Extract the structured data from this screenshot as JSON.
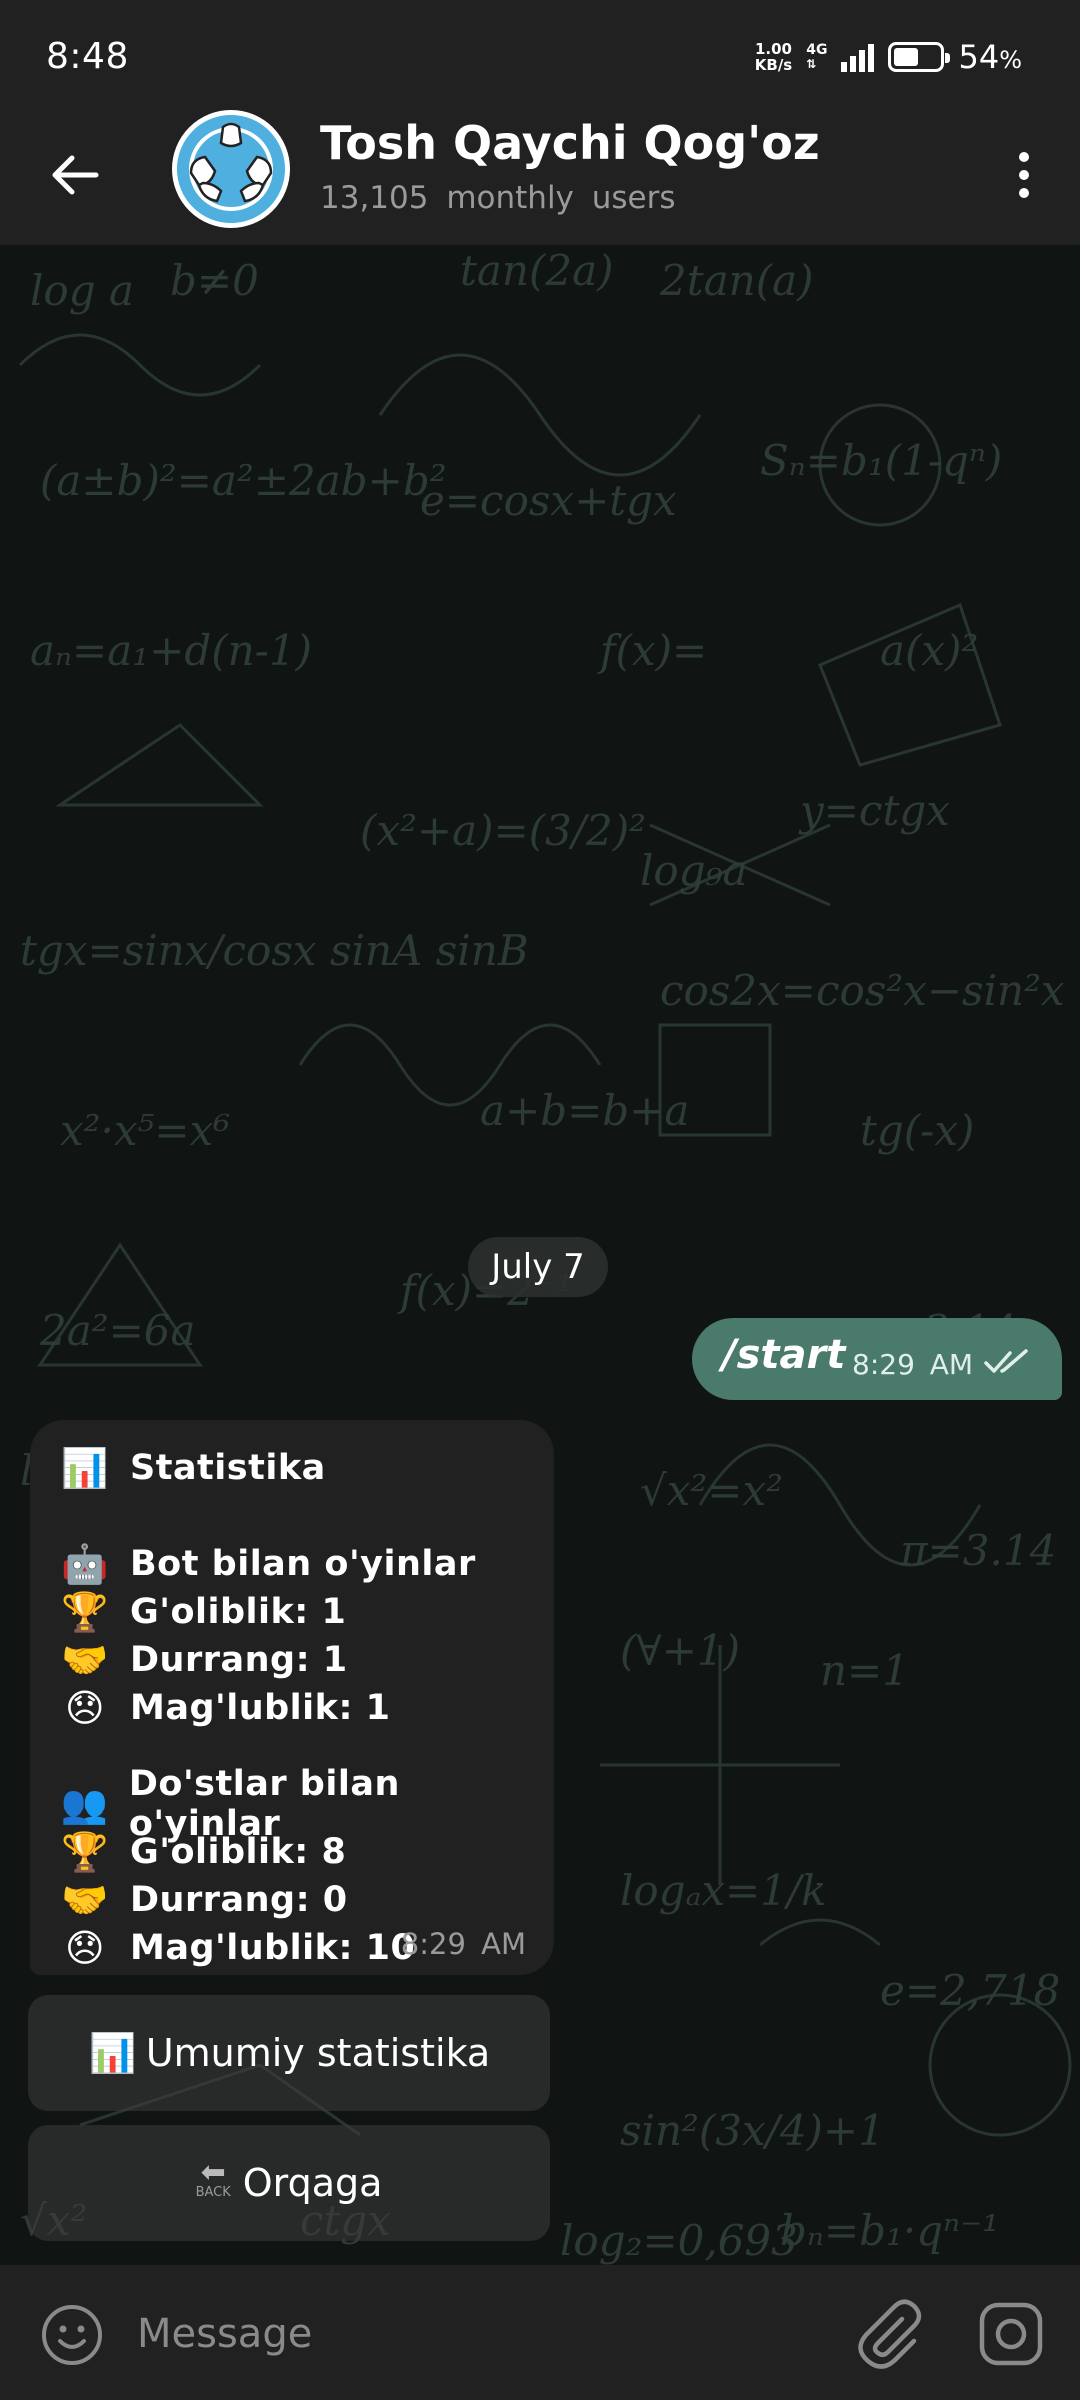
{
  "status_bar": {
    "time": "8:48",
    "net_speed_top": "1.00",
    "net_speed_bottom": "KB/s",
    "net_type": "4G",
    "battery_pct": "54",
    "battery_sign": "%",
    "battery_level": 0.54
  },
  "header": {
    "title": "Tosh Qaychi Qog'oz",
    "subtitle": "13,105 monthly users",
    "back_icon": "arrow-left-icon",
    "menu_icon": "more-vert-icon"
  },
  "chat": {
    "date_label": "July 7",
    "outgoing": {
      "text": "/start",
      "time": "8:29 AM",
      "status_icon": "double-check-icon"
    },
    "incoming": {
      "time": "8:29 AM",
      "lines": [
        {
          "emoji": "📊",
          "text": "Statistika"
        },
        {
          "emoji": "🤖",
          "text": "Bot bilan o'yinlar"
        },
        {
          "emoji": "🏆",
          "text": "G'oliblik: 1"
        },
        {
          "emoji": "🤝",
          "text": "Durrang: 1"
        },
        {
          "emoji": "😞",
          "text": "Mag'lublik: 1"
        },
        {
          "emoji": "👥",
          "text": "Do'stlar bilan o'yinlar"
        },
        {
          "emoji": "🏆",
          "text": "G'oliblik: 8"
        },
        {
          "emoji": "🤝",
          "text": "Durrang: 0"
        },
        {
          "emoji": "😞",
          "text": "Mag'lublik: 10"
        }
      ]
    },
    "keyboard": [
      {
        "emoji": "📊",
        "label": "Umumiy statistika"
      },
      {
        "emoji": "⬅",
        "emoji_caption": "BACK",
        "label": "Orqaga"
      }
    ]
  },
  "input_bar": {
    "placeholder": "Message",
    "icons": [
      "smile-icon",
      "paperclip-icon",
      "camera-icon"
    ]
  },
  "colors": {
    "bar_bg": "#212121",
    "outgoing_bubble": "#4a7a6c",
    "incoming_bubble": "#212121",
    "muted_text": "#9a9a9a"
  }
}
